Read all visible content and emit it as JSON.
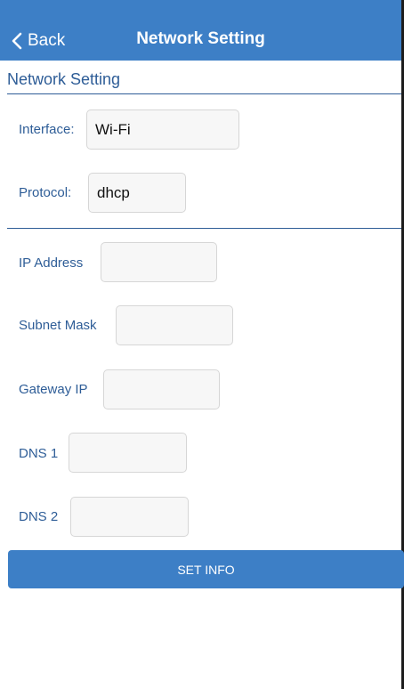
{
  "navbar": {
    "back_label": "Back",
    "title": "Network Setting"
  },
  "section": {
    "title": "Network Setting"
  },
  "form": {
    "interface_label": "Interface:",
    "interface_value": "Wi-Fi",
    "protocol_label": "Protocol:",
    "protocol_value": "dhcp",
    "ip_address_label": "IP Address",
    "ip_address_value": "",
    "subnet_mask_label": "Subnet Mask",
    "subnet_mask_value": "",
    "gateway_ip_label": "Gateway IP",
    "gateway_ip_value": "",
    "dns1_label": "DNS 1",
    "dns1_value": "",
    "dns2_label": "DNS 2",
    "dns2_value": ""
  },
  "actions": {
    "set_info_label": "SET INFO"
  },
  "colors": {
    "accent": "#3d7fc6",
    "label_text": "#2e5d97",
    "field_bg": "#f7f7f7"
  },
  "icons": {
    "back": "chevron-left-icon"
  }
}
